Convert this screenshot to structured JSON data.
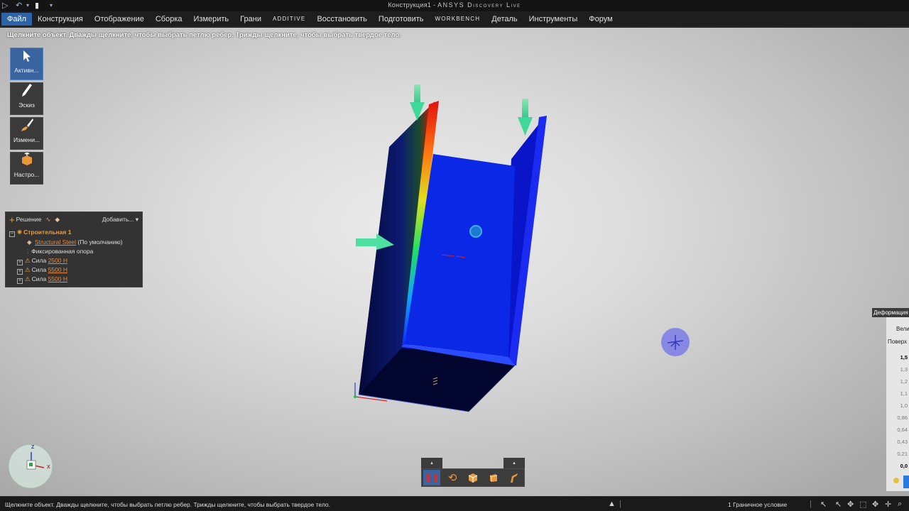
{
  "window": {
    "title_prefix": "Конструкция1 - ",
    "title_brand": "ANSYS Discovery Live"
  },
  "menu": [
    {
      "label": "Файл",
      "active": true
    },
    {
      "label": "Конструкция"
    },
    {
      "label": "Отображение"
    },
    {
      "label": "Сборка"
    },
    {
      "label": "Измерить"
    },
    {
      "label": "Грани"
    },
    {
      "label": "Additive",
      "caps": true
    },
    {
      "label": "Восстановить"
    },
    {
      "label": "Подготовить"
    },
    {
      "label": "Workbench",
      "caps": true
    },
    {
      "label": "Деталь"
    },
    {
      "label": "Инструменты"
    },
    {
      "label": "Форум"
    }
  ],
  "hint": "Щелкните объект. Дважды щелкните, чтобы выбрать петлю ребер. Трижды щелкните, чтобы выбрать твердое тело.",
  "tools": [
    {
      "label": "Активн..."
    },
    {
      "label": "Эскиз"
    },
    {
      "label": "Измени..."
    },
    {
      "label": "Настро..."
    }
  ],
  "tree": {
    "solution_label": "Решение",
    "add_label": "Добавить...",
    "root": "Строительная 1",
    "material": "Structural Steel",
    "material_note": "(По умолчанию)",
    "support": "Фиксированная опора",
    "force_label": "Сила",
    "forces": [
      "2500 Н",
      "5500 Н",
      "5500 Н"
    ]
  },
  "legend": {
    "title": "Деформация",
    "line2": "Вели",
    "line3": "Поверх",
    "ticks": [
      "1,5",
      "1,3",
      "1,2",
      "1,1",
      "1,0",
      "0,86",
      "0,64",
      "0,43",
      "0,21",
      "0,0"
    ]
  },
  "axes": {
    "z": "Z",
    "x": "X"
  },
  "status": {
    "text": "Щелкните объект. Дважды щелкните, чтобы выбрать петлю ребер. Трижды щелкните, чтобы выбрать твердое тело.",
    "condition": "1 Граничное условие"
  },
  "colors": {
    "accent": "#2f63a8",
    "link": "#e88a3a",
    "model_blue": "#0a28e6"
  }
}
